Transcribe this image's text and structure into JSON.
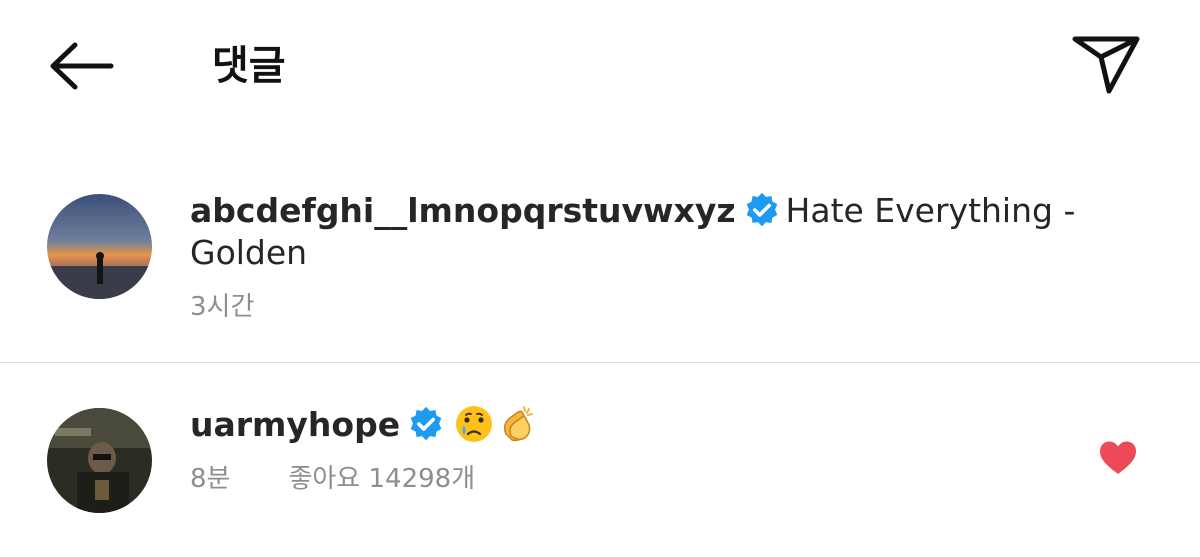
{
  "header": {
    "title": "댓글",
    "back_icon": "arrow-left-icon",
    "send_icon": "paper-plane-icon"
  },
  "caption_comment": {
    "username": "abcdefghi__lmnopqrstuvwxyz",
    "verified": true,
    "text": "Hate Everything - Golden",
    "time": "3시간"
  },
  "reply_comment": {
    "username": "uarmyhope",
    "verified": true,
    "emojis": [
      "crying-face-icon",
      "clapping-hands-icon"
    ],
    "time": "8분",
    "likes": "좋아요 14298개",
    "liked": true
  },
  "colors": {
    "verified_blue": "#1d9bf0",
    "like_red": "#ed4956",
    "meta_gray": "#8e8e8e",
    "divider": "#dbdbdb"
  }
}
